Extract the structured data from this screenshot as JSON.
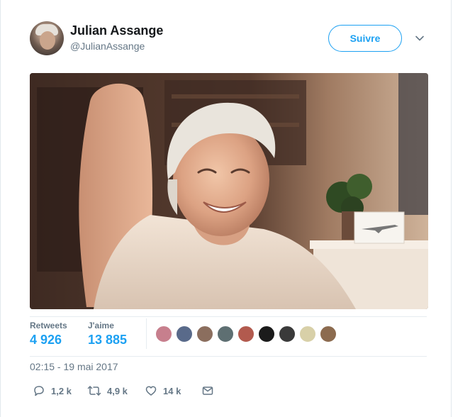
{
  "tweet": {
    "author_name": "Julian Assange",
    "author_handle": "@JulianAssange",
    "follow_label": "Suivre",
    "photo_alt": "Photo"
  },
  "stats": {
    "retweets_label": "Retweets",
    "retweets_value": "4 926",
    "likes_label": "J'aime",
    "likes_value": "13 885"
  },
  "likers": [
    {
      "color": "#c77f8d"
    },
    {
      "color": "#596a8a"
    },
    {
      "color": "#8b6e5e"
    },
    {
      "color": "#5e6f72"
    },
    {
      "color": "#b25a4e"
    },
    {
      "color": "#1b1b1b"
    },
    {
      "color": "#3a3a3a"
    },
    {
      "color": "#d8d0a8"
    },
    {
      "color": "#8c6b4f"
    }
  ],
  "timestamp": "02:15 - 19 mai 2017",
  "actions": {
    "reply_count": "1,2 k",
    "retweet_count": "4,9 k",
    "like_count": "14 k"
  },
  "colors": {
    "accent": "#1da1f2",
    "muted": "#657786",
    "text": "#14171a"
  },
  "icons": [
    "chevron-down-icon",
    "reply-icon",
    "retweet-icon",
    "like-icon",
    "message-icon"
  ]
}
